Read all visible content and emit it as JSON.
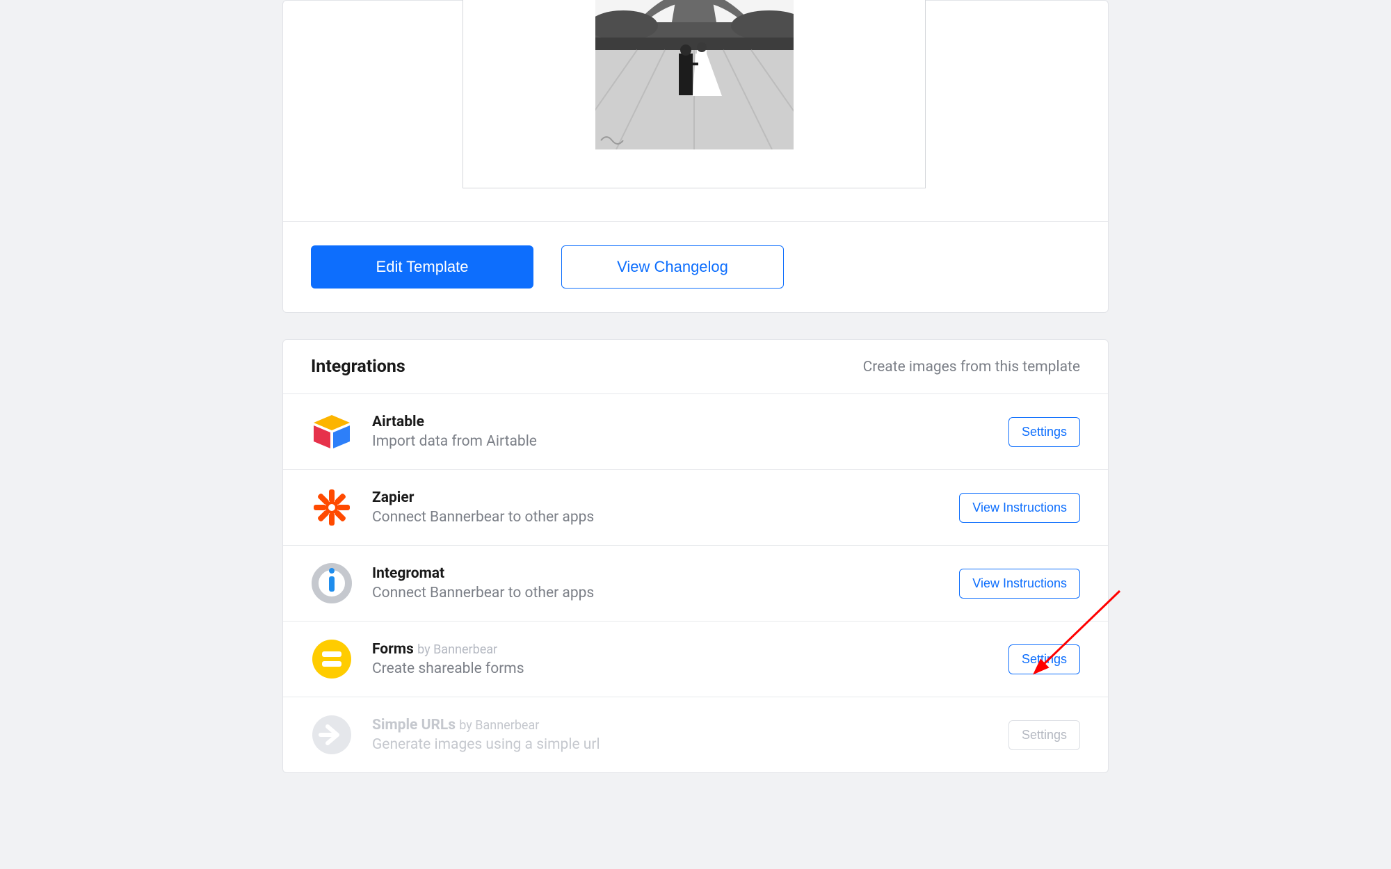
{
  "preview": {
    "edit_label": "Edit Template",
    "changelog_label": "View Changelog"
  },
  "integrations": {
    "heading": "Integrations",
    "hint": "Create images from this template",
    "rows": [
      {
        "name": "Airtable",
        "byline": "",
        "subtitle": "Import data from Airtable",
        "action_label": "Settings",
        "icon": "airtable-icon",
        "action_kind": "outline"
      },
      {
        "name": "Zapier",
        "byline": "",
        "subtitle": "Connect Bannerbear to other apps",
        "action_label": "View Instructions",
        "icon": "zapier-icon",
        "action_kind": "outline"
      },
      {
        "name": "Integromat",
        "byline": "",
        "subtitle": "Connect Bannerbear to other apps",
        "action_label": "View Instructions",
        "icon": "integromat-icon",
        "action_kind": "outline"
      },
      {
        "name": "Forms",
        "byline": "by Bannerbear",
        "subtitle": "Create shareable forms",
        "action_label": "Settings",
        "icon": "forms-icon",
        "action_kind": "outline"
      },
      {
        "name": "Simple URLs",
        "byline": "by Bannerbear",
        "subtitle": "Generate images using a simple url",
        "action_label": "Settings",
        "icon": "simple-urls-icon",
        "action_kind": "disabled"
      }
    ]
  },
  "arrow": {
    "color": "#ff0000"
  }
}
